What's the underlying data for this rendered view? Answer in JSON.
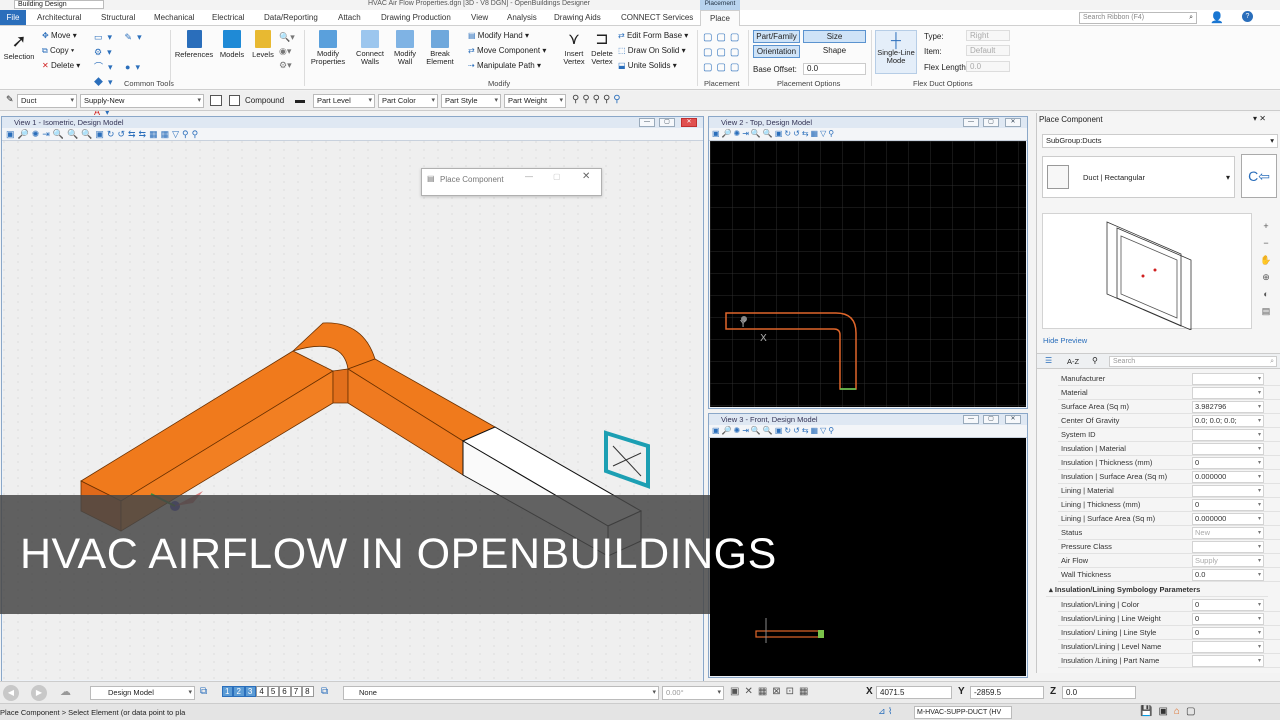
{
  "app": {
    "title": "HVAC Air Flow Properties.dgn [3D - V8 DGN] - OpenBuildings Designer",
    "workflow": "Building Design",
    "context_tab": "Placement",
    "search_placeholder": "Search Ribbon (F4)"
  },
  "tabs": [
    "File",
    "Architectural",
    "Structural",
    "Mechanical",
    "Electrical",
    "Data/Reporting",
    "Attach",
    "Drawing Production",
    "View",
    "Analysis",
    "Drawing Aids",
    "CONNECT Services",
    "Place"
  ],
  "ribbon": {
    "selection": "Selection",
    "move": "Move",
    "copy": "Copy",
    "delete": "Delete",
    "common_tools": "Common Tools",
    "references": "References",
    "models": "Models",
    "levels": "Levels",
    "modify_properties": "Modify Properties",
    "connect_walls": "Connect Walls",
    "modify_wall": "Modify Wall",
    "break_element": "Break Element",
    "modify_hand": "Modify Hand",
    "move_component": "Move Component",
    "manipulate_path": "Manipulate Path",
    "insert_vertex": "Insert Vertex",
    "delete_vertex": "Delete Vertex",
    "edit_form_base": "Edit Form Base",
    "draw_on_solid": "Draw On Solid",
    "unite_solids": "Unite Solids",
    "modify_group": "Modify",
    "placement_group": "Placement",
    "part_family": "Part/Family",
    "size": "Size",
    "orientation": "Orientation",
    "shape": "Shape",
    "base_offset_label": "Base Offset:",
    "base_offset_value": "0.0",
    "placement_options": "Placement Options",
    "single_line_mode": "Single-Line Mode",
    "type_label": "Type:",
    "type_value": "Right",
    "item_label": "Item:",
    "item_value": "Default",
    "flex_length_label": "Flex Length:",
    "flex_length_value": "0.0",
    "flex_duct_options": "Flex Duct Options"
  },
  "attrbar": {
    "type": "Duct",
    "system": "Supply-New",
    "compound": "Compound",
    "part_level": "Part Level",
    "part_color": "Part Color",
    "part_style": "Part Style",
    "part_weight": "Part Weight"
  },
  "views": {
    "v1": "View 1 - Isometric, Design Model",
    "v2": "View 2 - Top, Design Model",
    "v3": "View 3 - Front, Design Model"
  },
  "dialog": {
    "title": "Place Component"
  },
  "panel": {
    "title": "Place Component",
    "subgroup": "SubGroup:Ducts",
    "component": "Duct | Rectangular",
    "hide_preview": "Hide Preview",
    "az": "A-Z",
    "search": "Search",
    "properties": [
      {
        "label": "Manufacturer",
        "value": ""
      },
      {
        "label": "Material",
        "value": ""
      },
      {
        "label": "Surface Area (Sq m)",
        "value": "3.982796"
      },
      {
        "label": "Center Of Gravity",
        "value": "0.0; 0.0; 0.0;"
      },
      {
        "label": "System ID",
        "value": ""
      },
      {
        "label": "Insulation | Material",
        "value": ""
      },
      {
        "label": "Insulation | Thickness (mm)",
        "value": "0"
      },
      {
        "label": "Insulation | Surface Area (Sq m)",
        "value": "0.000000"
      },
      {
        "label": "Lining | Material",
        "value": ""
      },
      {
        "label": "Lining | Thickness (mm)",
        "value": "0"
      },
      {
        "label": "Lining | Surface Area (Sq m)",
        "value": "0.000000"
      },
      {
        "label": "Status",
        "value": "New"
      },
      {
        "label": "Pressure Class",
        "value": ""
      },
      {
        "label": "Air Flow",
        "value": "Supply"
      },
      {
        "label": "Wall Thickness",
        "value": "0.0"
      }
    ],
    "section": "Insulation/Lining Symbology Parameters",
    "section_props": [
      {
        "label": "Insulation/Lining | Color",
        "value": "0"
      },
      {
        "label": "Insulation/Lining | Line Weight",
        "value": "0"
      },
      {
        "label": "Insulation/ Lining | Line Style",
        "value": "0"
      },
      {
        "label": "Insulation/Lining | Level Name",
        "value": ""
      },
      {
        "label": "Insulation /Lining | Part Name",
        "value": ""
      }
    ]
  },
  "statusbar": {
    "model": "Design Model",
    "views": [
      "1",
      "2",
      "3",
      "4",
      "5",
      "6",
      "7",
      "8"
    ],
    "level": "None",
    "angle": "0.00°",
    "x_label": "X",
    "x_value": "4071.5",
    "y_label": "Y",
    "y_value": "-2859.5",
    "z_label": "Z",
    "z_value": "0.0"
  },
  "bottombar": {
    "prompt": "Place Component > Select Element (or data point to pla",
    "level_name": "M-HVAC-SUPP-DUCT (HV"
  },
  "banner": {
    "text": "HVAC AIRFLOW IN OPENBUILDINGS"
  },
  "colors": {
    "duct": "#f07a1c",
    "duct_dark": "#c05a0c",
    "file_tab": "#2a6ebb",
    "banner_bg": "#464646"
  }
}
